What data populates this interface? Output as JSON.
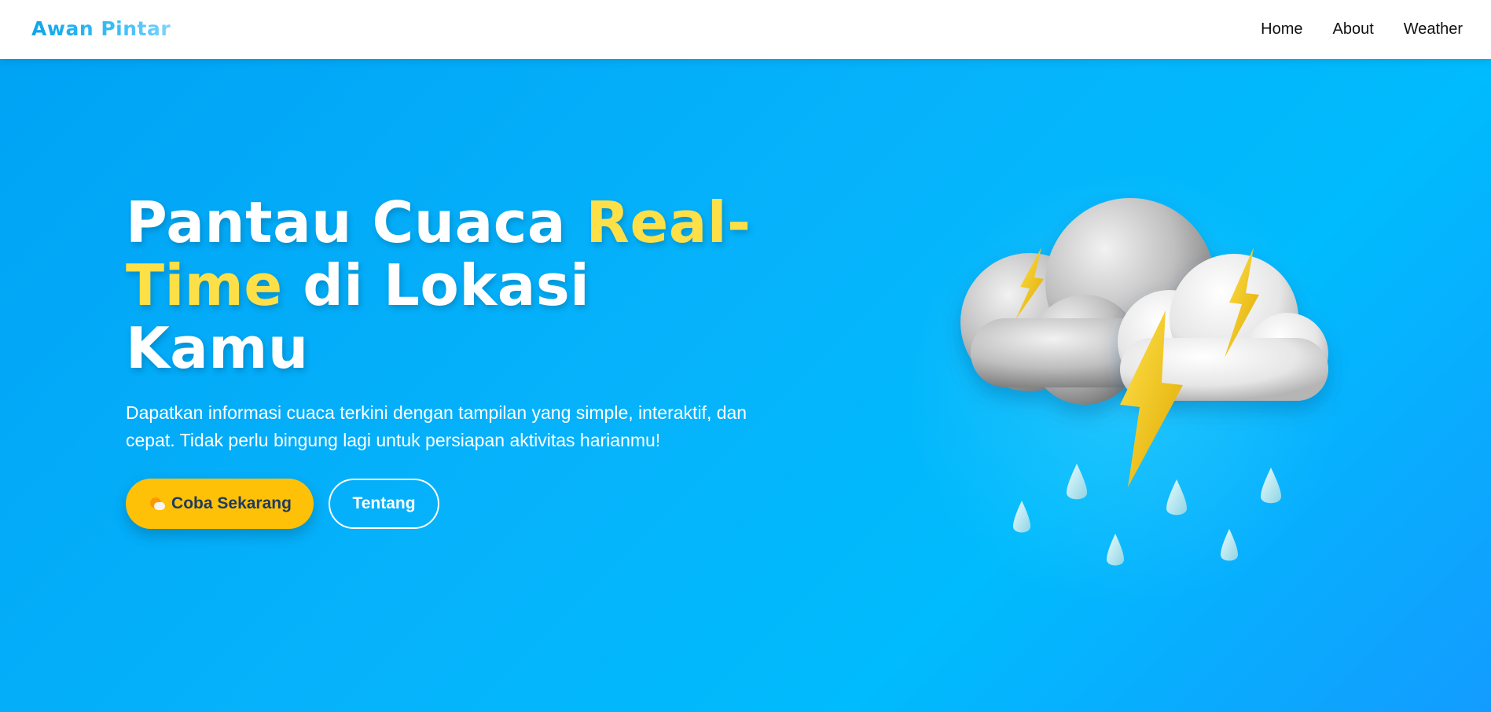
{
  "brand": {
    "name": "Awan Pintar"
  },
  "nav": {
    "links": [
      {
        "label": "Home"
      },
      {
        "label": "About"
      },
      {
        "label": "Weather"
      }
    ]
  },
  "hero": {
    "title_part1": "Pantau Cuaca ",
    "title_highlight1": "Real-",
    "title_highlight2": "Time",
    "title_part2": " di Lokasi Kamu",
    "description": "Dapatkan informasi cuaca terkini dengan tampilan yang simple, interaktif, dan cepat. Tidak perlu bingung lagi untuk persiapan aktivitas harianmu!",
    "primary_button": {
      "label": "Coba Sekarang",
      "icon": "sun-behind-cloud-icon"
    },
    "secondary_button": {
      "label": "Tentang"
    },
    "illustration": "thunderstorm-cloud-icon"
  },
  "colors": {
    "hero_background": "#06b3fb",
    "highlight": "#fde047",
    "primary_button": "#ffc107",
    "primary_button_text": "#1e3a5f",
    "logo": "#0ea5e9"
  }
}
